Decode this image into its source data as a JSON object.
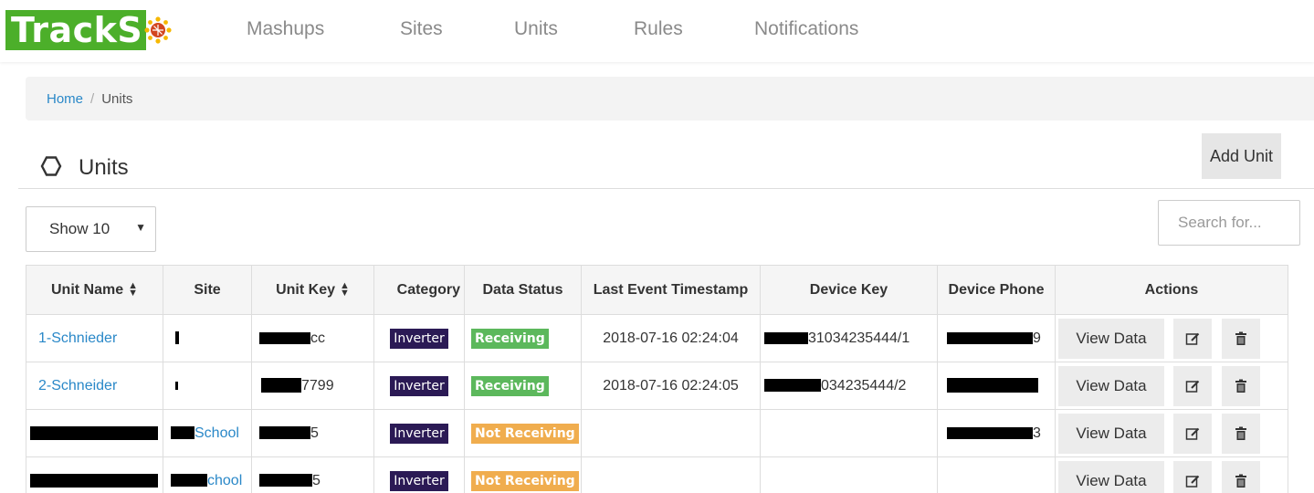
{
  "brand": {
    "name": "TrackSo",
    "logo_text": "TrackS",
    "logo_color": "#4caf2a"
  },
  "nav": [
    {
      "label": "Mashups"
    },
    {
      "label": "Sites"
    },
    {
      "label": "Units"
    },
    {
      "label": "Rules"
    },
    {
      "label": "Notifications"
    }
  ],
  "breadcrumb": {
    "home": "Home",
    "separator": "/",
    "current": "Units"
  },
  "page": {
    "icon": "cog-icon",
    "title": "Units",
    "add_button": "Add Unit"
  },
  "controls": {
    "page_size": "Show 10",
    "search_placeholder": "Search for..."
  },
  "table": {
    "columns": [
      "Unit Name",
      "Site",
      "Unit Key",
      "Category",
      "Data Status",
      "Last Event Timestamp",
      "Device Key",
      "Device Phone",
      "Actions"
    ],
    "rows": [
      {
        "unit_name": "1-Schnieder",
        "site": "",
        "unit_key": "cc",
        "category": "Inverter",
        "data_status": "Receiving",
        "last_event": "2018-07-16 02:24:04",
        "device_key": "31034235444/1",
        "device_phone": "9",
        "view": "View Data"
      },
      {
        "unit_name": "2-Schneider",
        "site": "",
        "unit_key": "7799",
        "category": "Inverter",
        "data_status": "Receiving",
        "last_event": "2018-07-16 02:24:05",
        "device_key": "034235444/2",
        "device_phone": "",
        "view": "View Data"
      },
      {
        "unit_name": "",
        "site": "School",
        "unit_key": "5",
        "category": "Inverter",
        "data_status": "Not Receiving",
        "last_event": "",
        "device_key": "",
        "device_phone": "3",
        "view": "View Data"
      },
      {
        "unit_name": "",
        "site": "chool",
        "unit_key": "5",
        "category": "Inverter",
        "data_status": "Not Receiving",
        "last_event": "",
        "device_key": "",
        "device_phone": "",
        "view": "View Data"
      }
    ]
  },
  "colors": {
    "link": "#2a88c8",
    "inverter": "#2b1a55",
    "receiving": "#5cb85c",
    "not_receiving": "#f0ad4e"
  }
}
